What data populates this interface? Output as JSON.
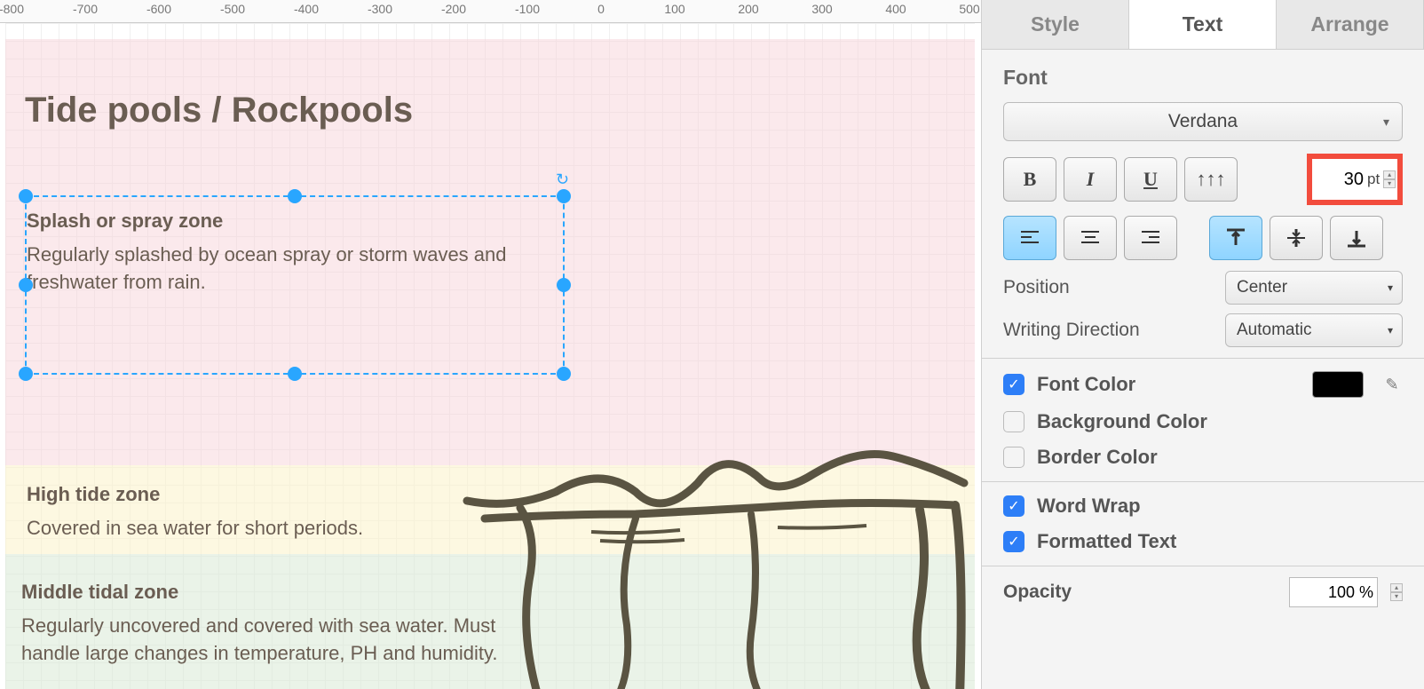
{
  "ruler_ticks": [
    "-800",
    "-700",
    "-600",
    "-500",
    "-400",
    "-300",
    "-200",
    "-100",
    "0",
    "100",
    "200",
    "300",
    "400",
    "500"
  ],
  "canvas": {
    "title": "Tide pools / Rockpools",
    "selected": {
      "heading": "Splash or spray zone",
      "desc": "Regularly splashed by ocean spray or storm waves and freshwater from rain."
    },
    "high": {
      "heading": "High tide zone",
      "desc": "Covered in sea water for short periods."
    },
    "middle": {
      "heading": "Middle tidal zone",
      "desc": "Regularly uncovered and covered with sea water. Must handle large changes in temperature, PH and humidity."
    }
  },
  "sidebar": {
    "tabs": {
      "style": "Style",
      "text": "Text",
      "arrange": "Arrange"
    },
    "font_section": "Font",
    "font_family": "Verdana",
    "font_size": "30",
    "font_size_unit": "pt",
    "position_label": "Position",
    "position_value": "Center",
    "direction_label": "Writing Direction",
    "direction_value": "Automatic",
    "font_color_label": "Font Color",
    "font_color_value": "#000000",
    "bg_color_label": "Background Color",
    "border_color_label": "Border Color",
    "word_wrap_label": "Word Wrap",
    "formatted_label": "Formatted Text",
    "opacity_label": "Opacity",
    "opacity_value": "100 %"
  }
}
